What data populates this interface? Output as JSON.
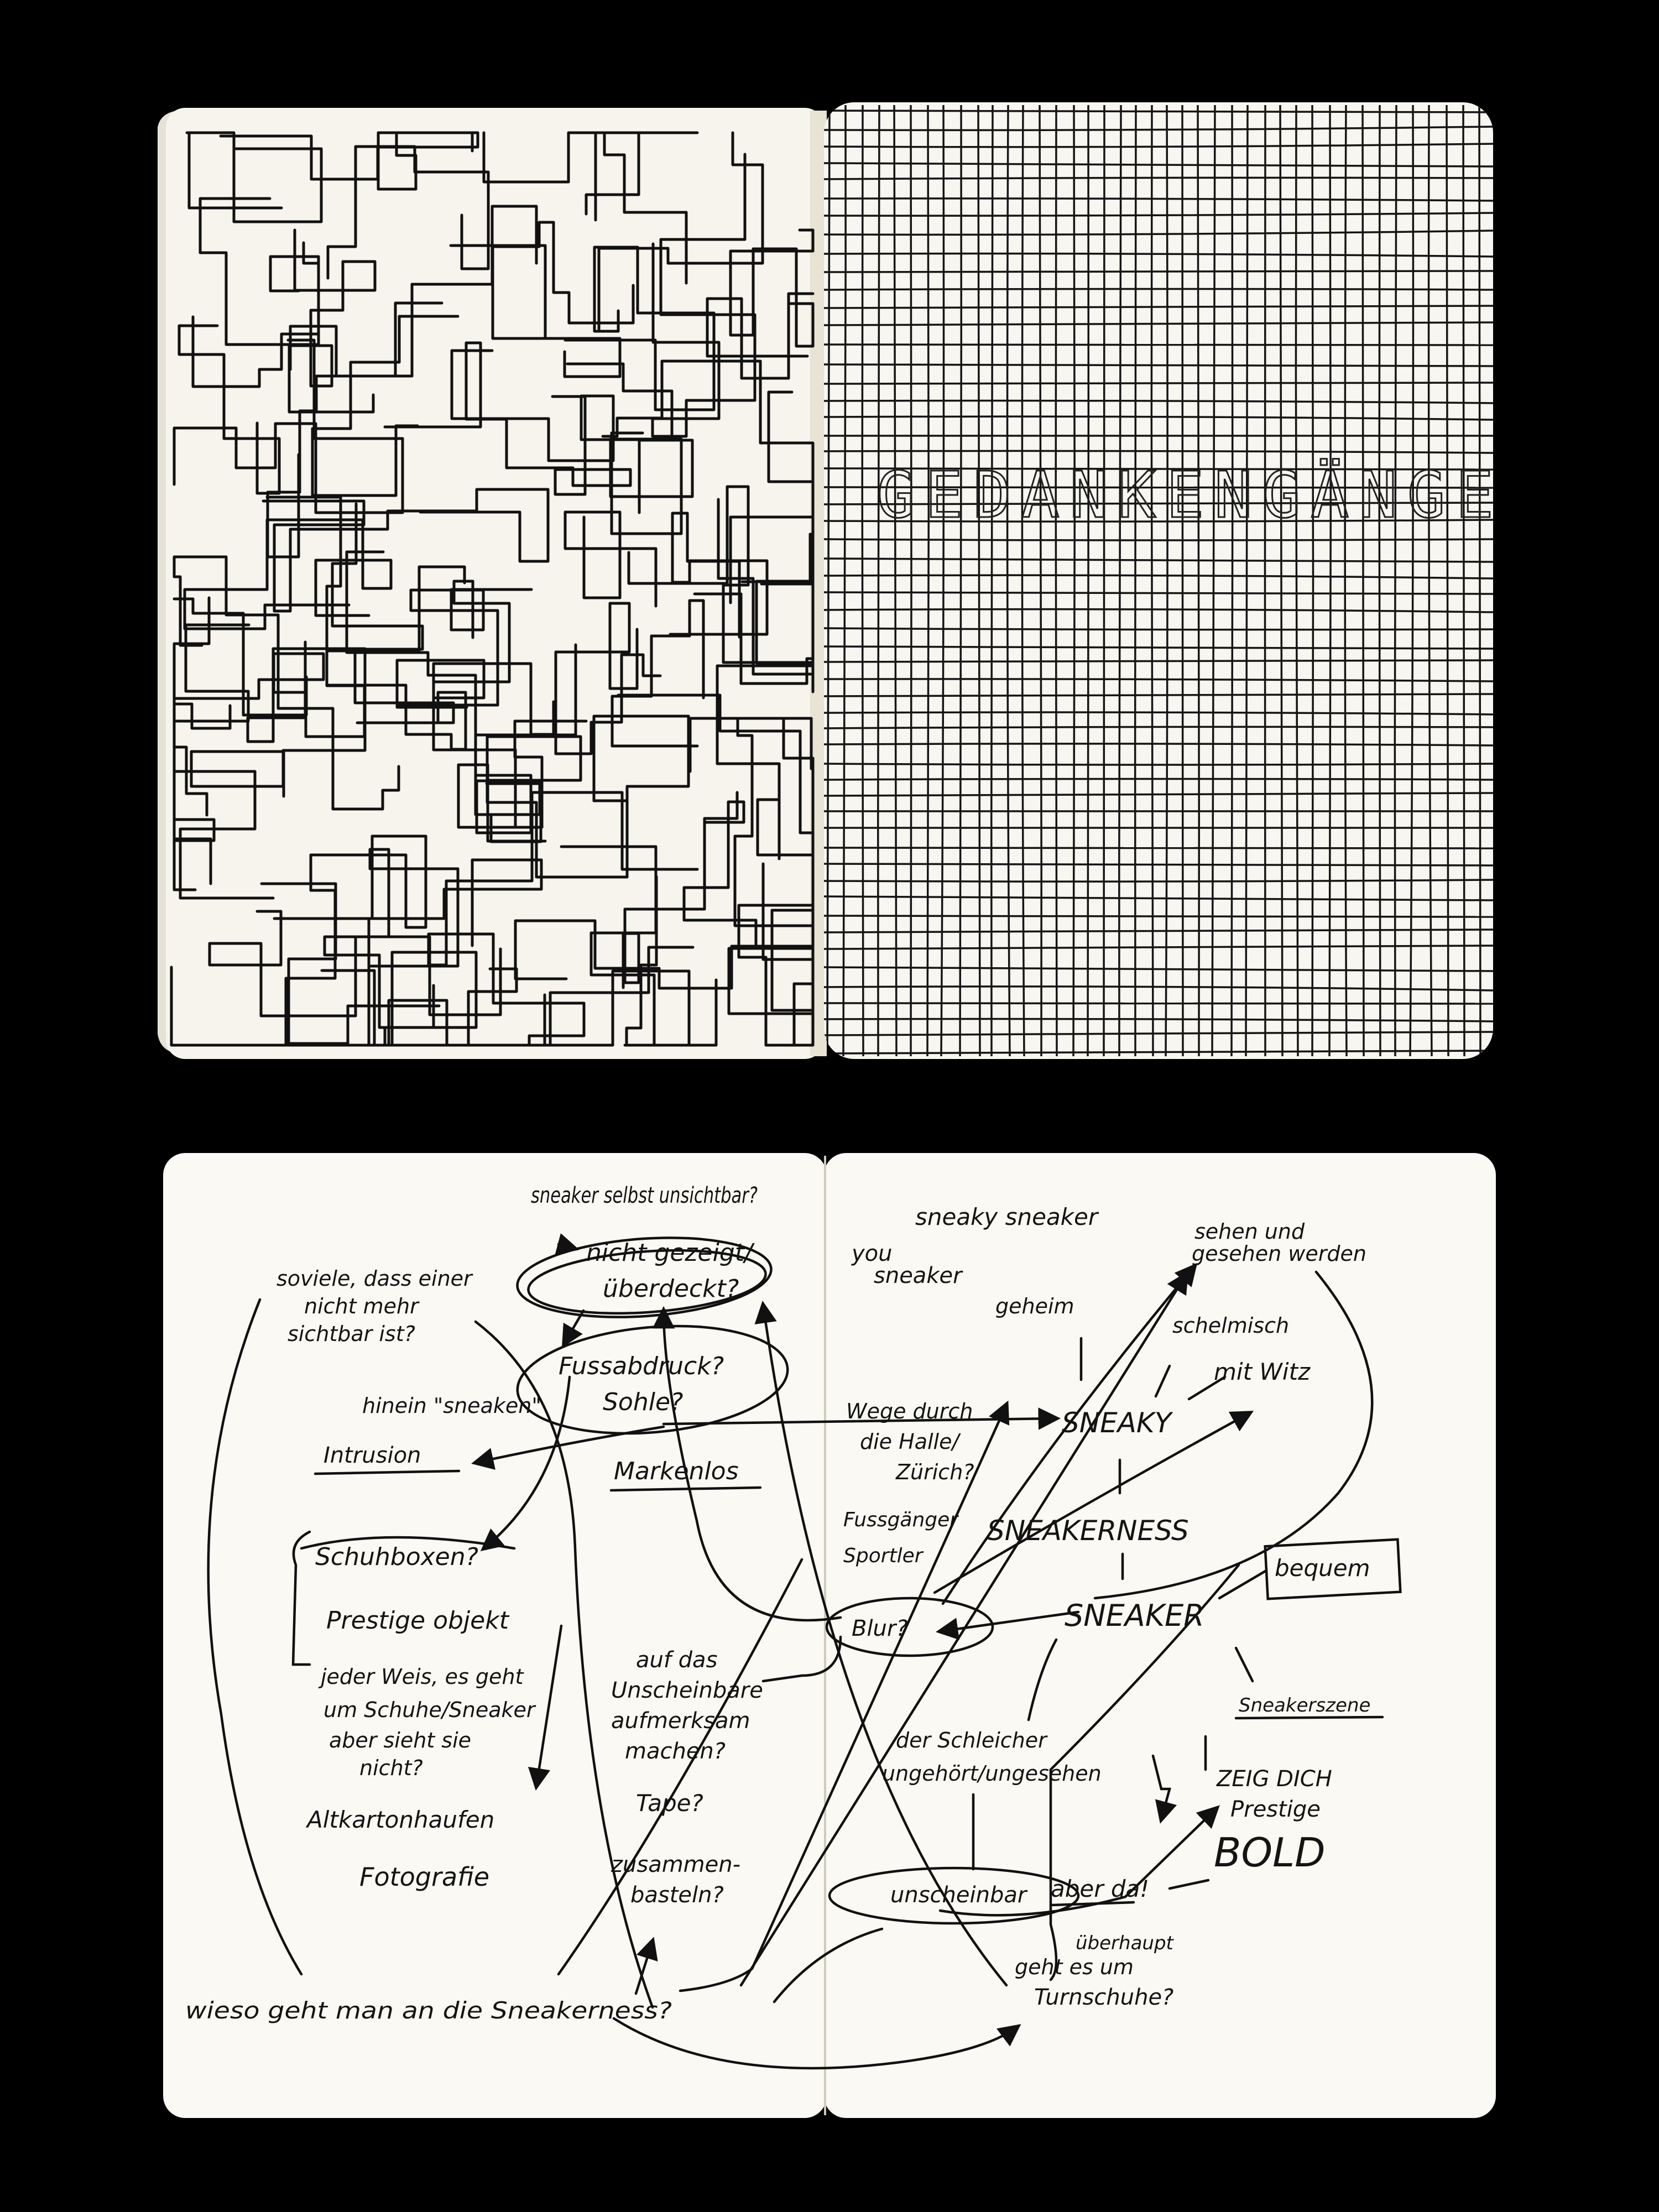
{
  "spread_top": {
    "right_page_title": "GEDANKENGÄNGE"
  },
  "spread_bottom": {
    "notes": {
      "sneaker_unsichtbar": "sneaker selbst unsichtbar?",
      "nicht_gezeigt": "nicht gezeigt/",
      "ueberdeckt": "überdeckt?",
      "soviele_1": "soviele, dass einer",
      "soviele_2": "nicht mehr",
      "soviele_3": "sichtbar ist?",
      "fussabdruck": "Fussabdruck?",
      "sohle": "Sohle?",
      "hinein_sneaken": "hinein \"sneaken\"",
      "intrusion": "Intrusion",
      "markenlos": "Markenlos",
      "schuhboxen": "Schuhboxen?",
      "prestige_objekt": "Prestige objekt",
      "jeder_weiss_1": "jeder Weis, es geht",
      "jeder_weiss_2": "um Schuhe/Sneaker",
      "jeder_weiss_3": "aber sieht sie",
      "jeder_weiss_4": "nicht?",
      "altkarton": "Altkartonhaufen",
      "fotografie": "Fotografie",
      "auf_das_1": "auf das",
      "auf_das_2": "Unscheinbare",
      "auf_das_3": "aufmerksam",
      "auf_das_4": "machen?",
      "tape": "Tape?",
      "zusammen_1": "zusammen-",
      "zusammen_2": "basteln?",
      "wieso": "wieso geht man an die Sneakerness?",
      "sneaky_sneaker": "sneaky sneaker",
      "you_sneaker_1": "you",
      "you_sneaker_2": "sneaker",
      "sehen_1": "sehen und",
      "sehen_2": "gesehen werden",
      "geheim": "geheim",
      "schelmisch": "schelmisch",
      "mit_witz": "mit Witz",
      "wege_1": "Wege durch",
      "wege_2": "die Halle/",
      "wege_3": "Zürich?",
      "sneaky": "SNEAKY",
      "fussgaenger_1": "Fussgänger",
      "fussgaenger_2": "Sportler",
      "sneakerness": "SNEAKERNESS",
      "bequem": "bequem",
      "blur": "Blur?",
      "sneaker": "SNEAKER",
      "sneakerszene": "Sneakerszene",
      "schleicher_1": "der Schleicher",
      "schleicher_2": "ungehört/ungesehen",
      "zeig_dich": "ZEIG DICH",
      "prestige": "Prestige",
      "bold": "BOLD",
      "unscheinbar": "unscheinbar",
      "aber_da": "aber da!",
      "ueberhaupt": "überhaupt",
      "geht_es_um": "geht es um",
      "turnschuhe": "Turnschuhe?"
    }
  }
}
